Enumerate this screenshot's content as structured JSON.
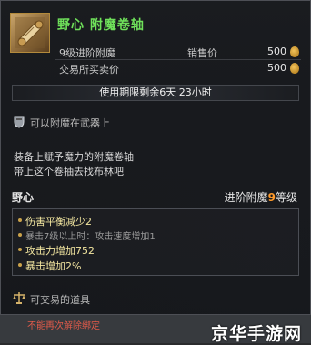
{
  "item": {
    "title": "野心 附魔卷轴",
    "icon": "scroll-icon"
  },
  "prices": [
    {
      "label": "9级进阶附魔",
      "mid": "销售价",
      "value": "500"
    },
    {
      "label": "交易所买卖价",
      "mid": "",
      "value": "500"
    }
  ],
  "expire_text": "使用期限剩余6天 23小时",
  "weapon_enchant": "可以附魔在武器上",
  "description": [
    "装备上赋予魔力的附魔卷轴",
    "带上这个卷抽去找布林吧"
  ],
  "enchant": {
    "name": "野心",
    "grade_prefix": "进阶附魔",
    "grade_num": "9",
    "grade_suffix": "等级"
  },
  "stats": [
    {
      "text": "伤害平衡减少2",
      "kind": "main"
    },
    {
      "text": "暴击7级以上时：攻击速度增加1",
      "kind": "sub"
    },
    {
      "text": "攻击力增加752",
      "kind": "main"
    },
    {
      "text": "暴击增加2%",
      "kind": "main"
    }
  ],
  "tradeable": "可交易的道具",
  "no_rebind": "不能再次解除绑定",
  "watermark": "京华手游网",
  "colors": {
    "title_green": "#6fe05a",
    "grade_orange": "#ff9a2a",
    "warning_red": "#e05a4a"
  }
}
